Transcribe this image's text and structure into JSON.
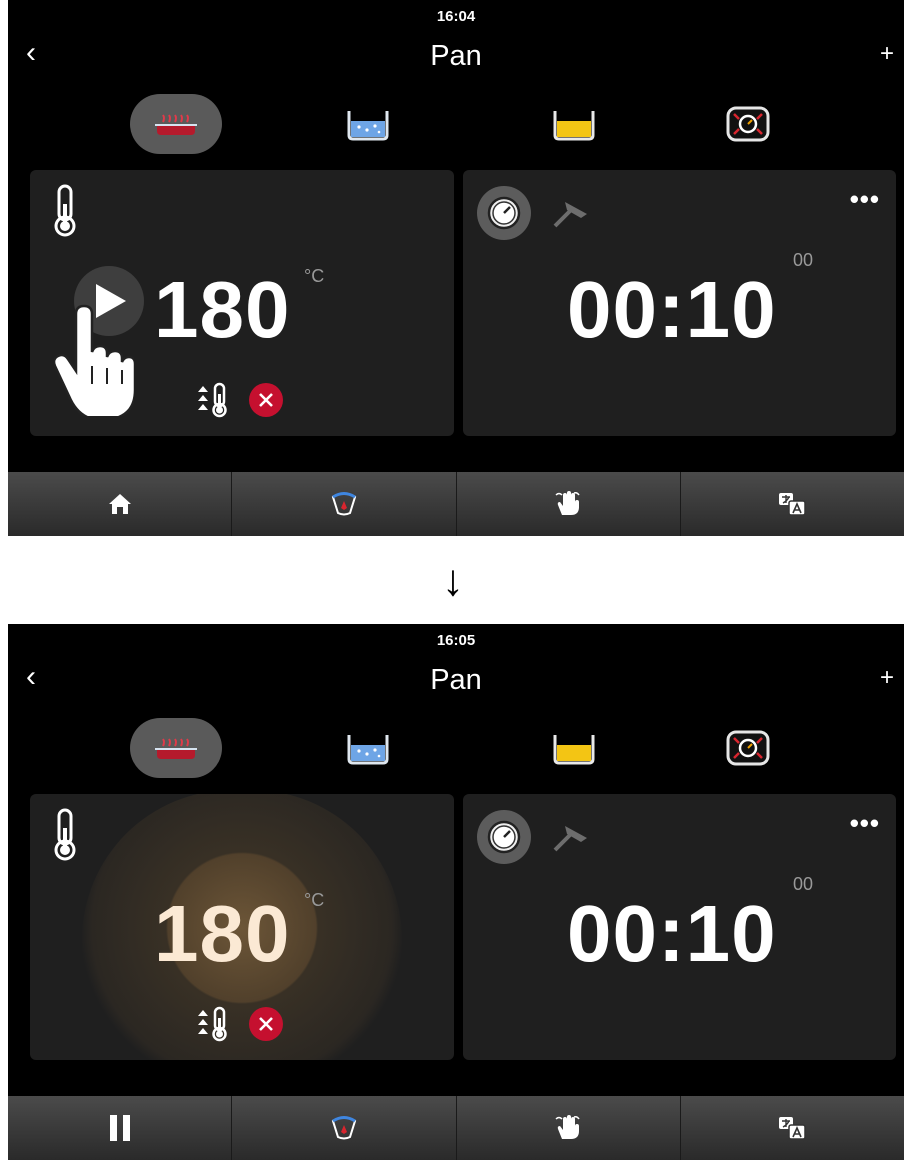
{
  "screens": [
    {
      "clock": "16:04",
      "back_label": "‹",
      "title": "Pan",
      "plus_label": "+",
      "temperature": {
        "value": "180",
        "unit": "°C"
      },
      "timer": {
        "value": "00:10",
        "seconds": "00"
      },
      "more_label": "•••",
      "state": "stopped"
    },
    {
      "clock": "16:05",
      "back_label": "‹",
      "title": "Pan",
      "plus_label": "+",
      "temperature": {
        "value": "180",
        "unit": "°C"
      },
      "timer": {
        "value": "00:10",
        "seconds": "00"
      },
      "more_label": "•••",
      "state": "heating"
    }
  ],
  "transition_arrow": "↓",
  "modes": [
    "frying-mode-icon",
    "water-bath-mode-icon",
    "oil-mode-icon",
    "temperature-control-mode-icon"
  ],
  "nav": [
    "home-icon",
    "dial-icon",
    "hand-gesture-icon",
    "language-icon"
  ],
  "colors": {
    "accent_red": "#c5102f",
    "oil_yellow": "#f3c514",
    "water_blue": "#6ea5e6",
    "panel": "#1f1f1f"
  }
}
